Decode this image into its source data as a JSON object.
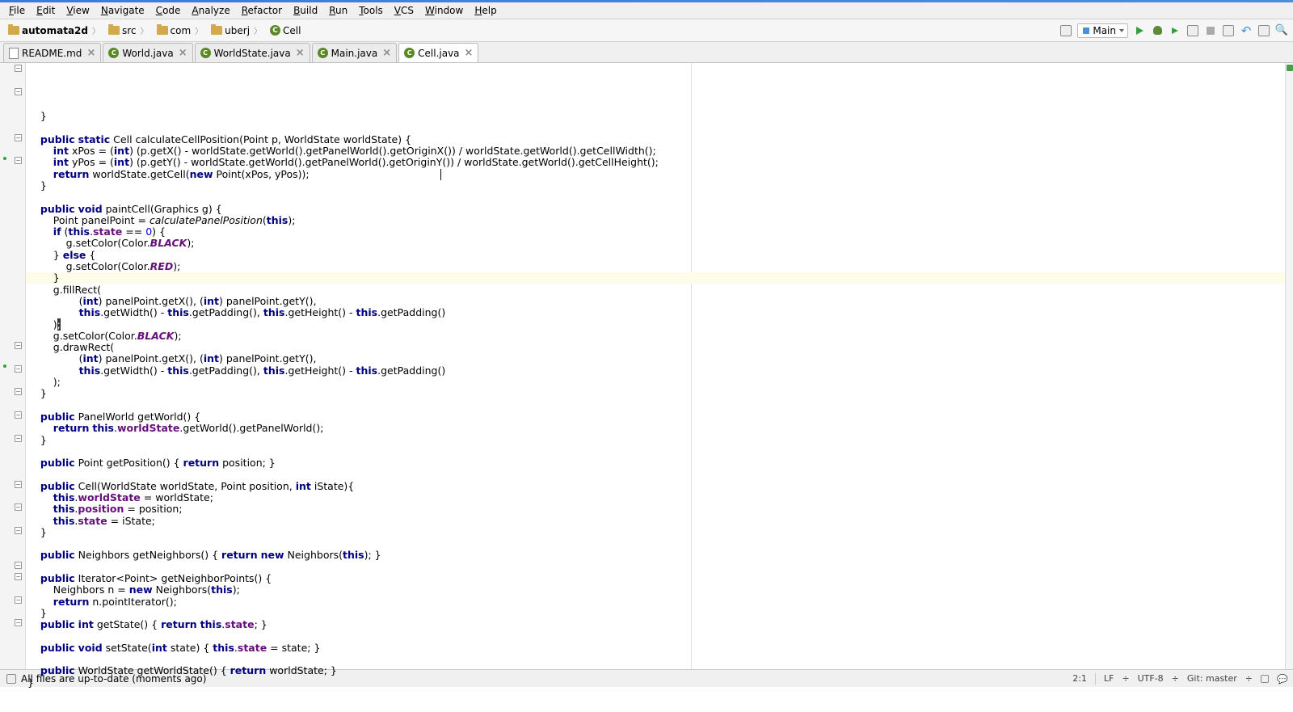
{
  "menu": [
    "File",
    "Edit",
    "View",
    "Navigate",
    "Code",
    "Analyze",
    "Refactor",
    "Build",
    "Run",
    "Tools",
    "VCS",
    "Window",
    "Help"
  ],
  "breadcrumbs": [
    {
      "icon": "folder",
      "label": "automata2d",
      "bold": true
    },
    {
      "icon": "folder",
      "label": "src"
    },
    {
      "icon": "folder",
      "label": "com"
    },
    {
      "icon": "folder",
      "label": "uberj"
    },
    {
      "icon": "class",
      "label": "Cell"
    }
  ],
  "runconfig": "Main",
  "tabs": [
    {
      "icon": "file",
      "label": "README.md",
      "active": false
    },
    {
      "icon": "java",
      "label": "World.java",
      "active": false
    },
    {
      "icon": "java",
      "label": "WorldState.java",
      "active": false
    },
    {
      "icon": "java",
      "label": "Main.java",
      "active": false
    },
    {
      "icon": "java",
      "label": "Cell.java",
      "active": true
    }
  ],
  "code": {
    "lines": [
      "    }",
      "",
      "    public static Cell calculateCellPosition(Point p, WorldState worldState) {",
      "        int xPos = (int) (p.getX() - worldState.getWorld().getPanelWorld().getOriginX()) / worldState.getWorld().getCellWidth();",
      "        int yPos = (int) (p.getY() - worldState.getWorld().getPanelWorld().getOriginY()) / worldState.getWorld().getCellHeight();",
      "        return worldState.getCell(new Point(xPos, yPos));",
      "    }",
      "",
      "    public void paintCell(Graphics g) {",
      "        Point panelPoint = calculatePanelPosition(this);",
      "        if (this.state == 0) {",
      "            g.setColor(Color.BLACK);",
      "        } else {",
      "            g.setColor(Color.RED);",
      "        }",
      "        g.fillRect(",
      "                (int) panelPoint.getX(), (int) panelPoint.getY(),",
      "                this.getWidth() - this.getPadding(), this.getHeight() - this.getPadding()",
      "        );",
      "        g.setColor(Color.BLACK);",
      "        g.drawRect(",
      "                (int) panelPoint.getX(), (int) panelPoint.getY(),",
      "                this.getWidth() - this.getPadding(), this.getHeight() - this.getPadding()",
      "        );",
      "    }",
      "",
      "    public PanelWorld getWorld() {",
      "        return this.worldState.getWorld().getPanelWorld();",
      "    }",
      "",
      "    public Point getPosition() { return position; }",
      "",
      "    public Cell(WorldState worldState, Point position, int iState){",
      "        this.worldState = worldState;",
      "        this.position = position;",
      "        this.state = iState;",
      "    }",
      "",
      "    public Neighbors getNeighbors() { return new Neighbors(this); }",
      "",
      "    public Iterator<Point> getNeighborPoints() {",
      "        Neighbors n = new Neighbors(this);",
      "        return n.pointIterator();",
      "    }",
      "    public int getState() { return this.state; }",
      "",
      "    public void setState(int state) { this.state = state; }",
      "",
      "    public WorldState getWorldState() { return worldState; }",
      "}"
    ],
    "highlighted_line_index": 18,
    "caret_text": ";"
  },
  "status": {
    "message": "All files are up-to-date (moments ago)",
    "pos": "2:1",
    "line_sep": "LF",
    "encoding": "UTF-8",
    "git": "Git: master"
  }
}
